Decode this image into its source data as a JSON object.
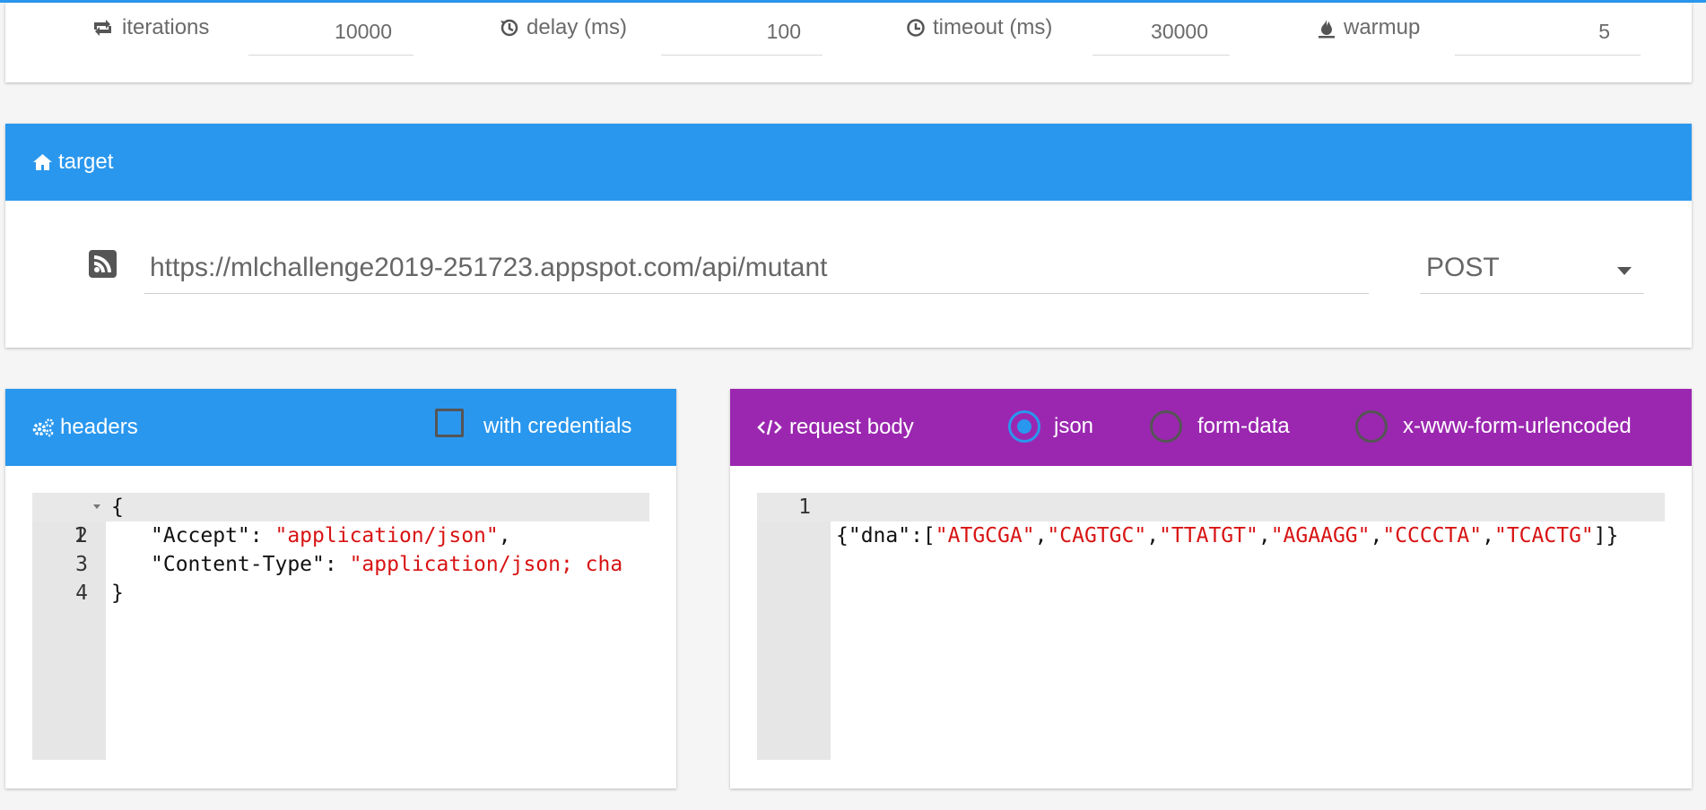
{
  "params": {
    "iterations": {
      "label": "iterations",
      "value": "10000",
      "icon": "retweet-icon"
    },
    "delay": {
      "label": "delay (ms)",
      "value": "100",
      "icon": "history-icon"
    },
    "timeout": {
      "label": "timeout (ms)",
      "value": "30000",
      "icon": "clock-icon"
    },
    "warmup": {
      "label": "warmup",
      "value": "5",
      "icon": "flame-icon"
    }
  },
  "target": {
    "title": "target",
    "url": "https://mlchallenge2019-251723.appspot.com/api/mutant",
    "method": "POST"
  },
  "headers": {
    "title": "headers",
    "credentials_label": "with credentials",
    "lines": [
      {
        "n": "1",
        "text": "{"
      },
      {
        "n": "2",
        "key": "\"Accept\"",
        "val": "\"application/json\""
      },
      {
        "n": "3",
        "key": "\"Content-Type\"",
        "val": "\"application/json; cha"
      },
      {
        "n": "4",
        "text": "}"
      }
    ]
  },
  "request_body": {
    "title": "request body",
    "options": [
      "json",
      "form-data",
      "x-www-form-urlencoded"
    ],
    "selected": "json",
    "line_number": "1",
    "line_parts": [
      {
        "t": "{\"dna\":[",
        "s": false
      },
      {
        "t": "\"ATGCGA\"",
        "s": true
      },
      {
        "t": ",",
        "s": false
      },
      {
        "t": "\"CAGTGC\"",
        "s": true
      },
      {
        "t": ",",
        "s": false
      },
      {
        "t": "\"TTATGT\"",
        "s": true
      },
      {
        "t": ",",
        "s": false
      },
      {
        "t": "\"AGAAGG\"",
        "s": true
      },
      {
        "t": ",",
        "s": false
      },
      {
        "t": "\"CCCCTA\"",
        "s": true
      },
      {
        "t": ",",
        "s": false
      },
      {
        "t": "\"TCACTG\"",
        "s": true
      },
      {
        "t": "]}",
        "s": false
      }
    ]
  },
  "colors": {
    "blue": "#2a97ee",
    "purple": "#9b27b0",
    "string": "#d81313"
  }
}
